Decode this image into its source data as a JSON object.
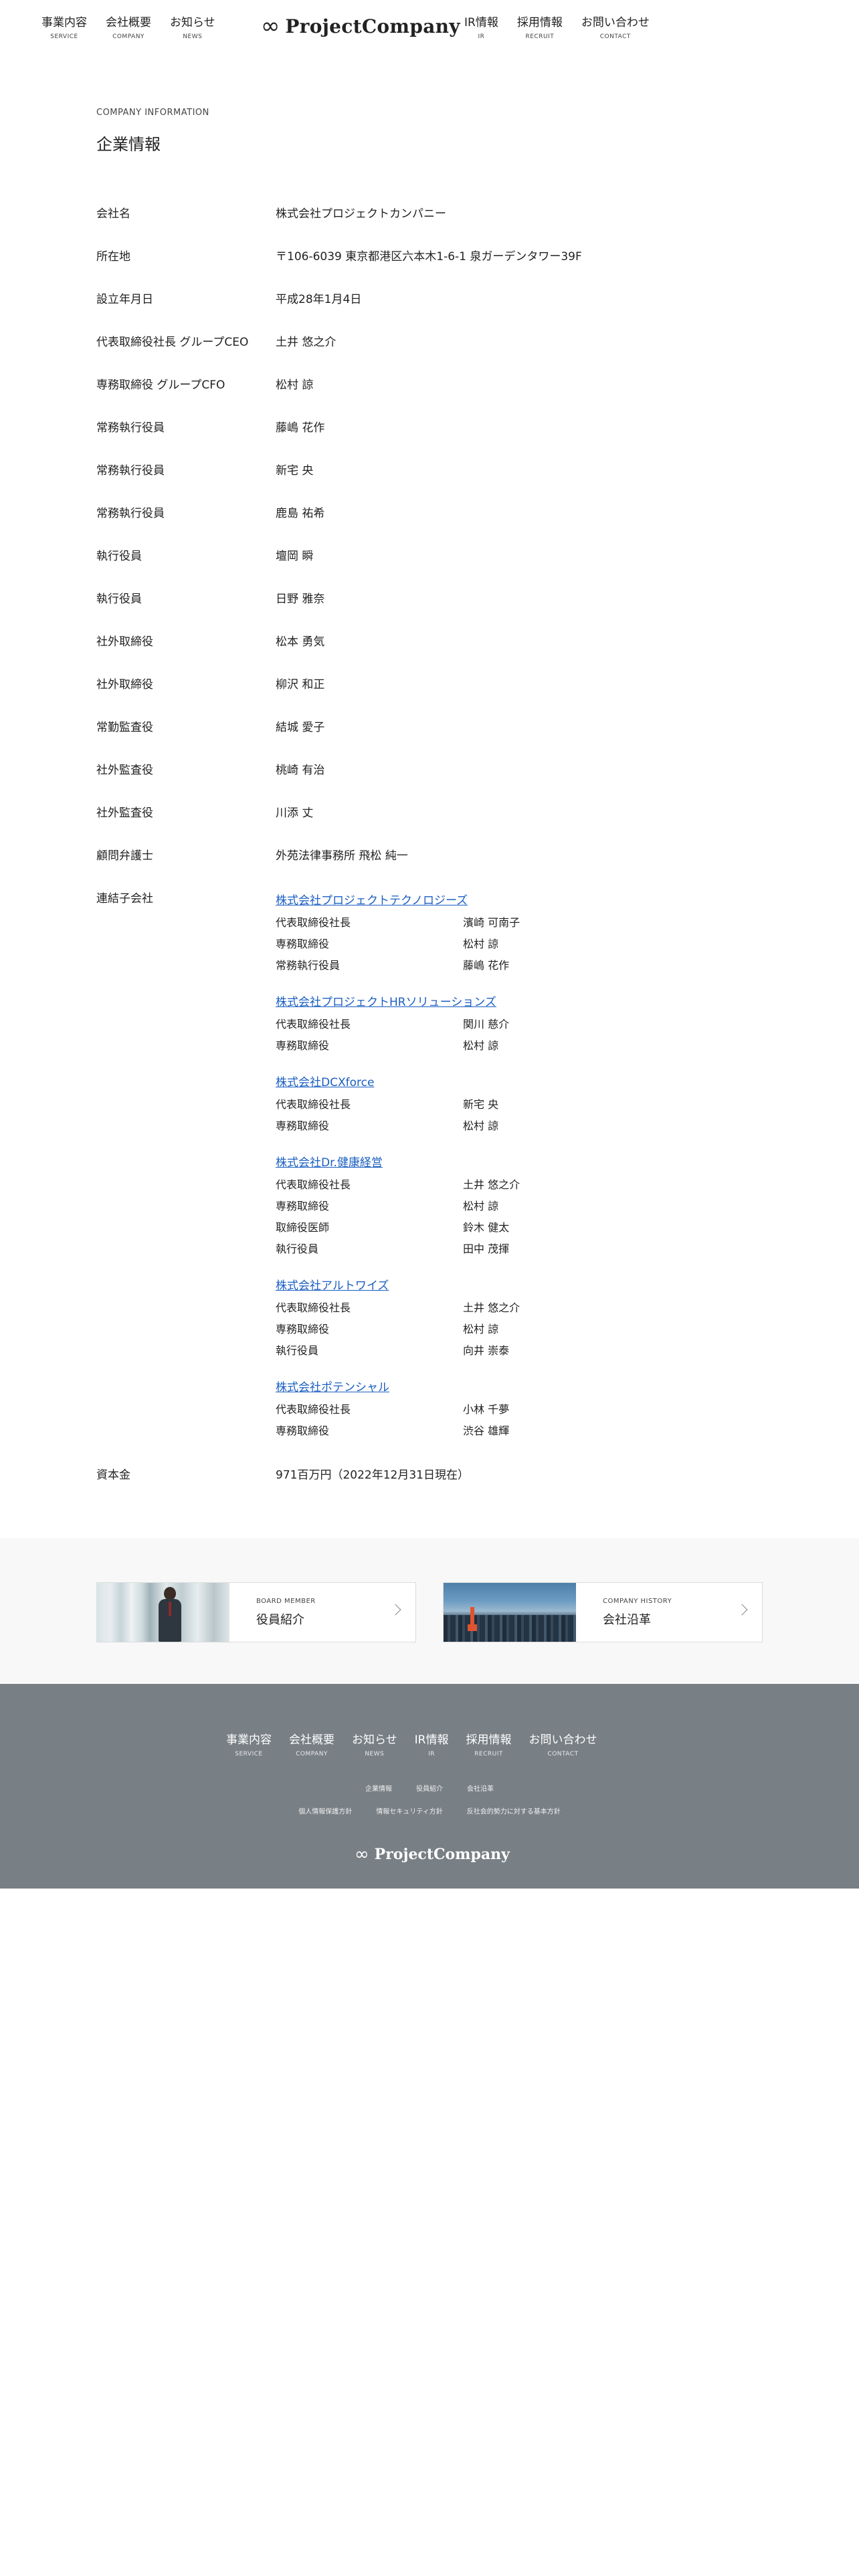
{
  "header": {
    "nav_left": [
      {
        "jp": "事業内容",
        "en": "SERVICE"
      },
      {
        "jp": "会社概要",
        "en": "COMPANY"
      },
      {
        "jp": "お知らせ",
        "en": "NEWS"
      }
    ],
    "logo_mark": "∞",
    "logo_text": "ProjectCompany",
    "nav_right": [
      {
        "jp": "IR情報",
        "en": "IR"
      },
      {
        "jp": "採用情報",
        "en": "RECRUIT"
      },
      {
        "jp": "お問い合わせ",
        "en": "CONTACT"
      }
    ]
  },
  "page": {
    "eyebrow": "COMPANY INFORMATION",
    "title": "企業情報"
  },
  "info": {
    "rows": [
      {
        "label": "会社名",
        "value": "株式会社プロジェクトカンパニー"
      },
      {
        "label": "所在地",
        "value": "〒106-6039 東京都港区六本木1-6-1 泉ガーデンタワー39F"
      },
      {
        "label": "設立年月日",
        "value": "平成28年1月4日"
      },
      {
        "label": "代表取締役社長 グループCEO",
        "value": "土井 悠之介"
      },
      {
        "label": "専務取締役 グループCFO",
        "value": "松村 諒"
      },
      {
        "label": "常務執行役員",
        "value": "藤嶋 花作"
      },
      {
        "label": "常務執行役員",
        "value": "新宅 央"
      },
      {
        "label": "常務執行役員",
        "value": "鹿島 祐希"
      },
      {
        "label": "執行役員",
        "value": "壇岡 瞬"
      },
      {
        "label": "執行役員",
        "value": "日野 雅奈"
      },
      {
        "label": "社外取締役",
        "value": "松本 勇気"
      },
      {
        "label": "社外取締役",
        "value": "柳沢 和正"
      },
      {
        "label": "常勤監査役",
        "value": "結城 愛子"
      },
      {
        "label": "社外監査役",
        "value": "桃崎 有治"
      },
      {
        "label": "社外監査役",
        "value": "川添 丈"
      },
      {
        "label": "顧問弁護士",
        "value": "外苑法律事務所 飛松 純一"
      }
    ],
    "subsidiaries_label": "連結子会社",
    "subsidiaries": [
      {
        "name": "株式会社プロジェクトテクノロジーズ",
        "officers": [
          {
            "role": "代表取締役社長",
            "name": "濱崎 可南子"
          },
          {
            "role": "専務取締役",
            "name": "松村 諒"
          },
          {
            "role": "常務執行役員",
            "name": "藤嶋 花作"
          }
        ]
      },
      {
        "name": "株式会社プロジェクトHRソリューションズ",
        "officers": [
          {
            "role": "代表取締役社長",
            "name": "関川 慈介"
          },
          {
            "role": "専務取締役",
            "name": "松村 諒"
          }
        ]
      },
      {
        "name": "株式会社DCXforce",
        "officers": [
          {
            "role": "代表取締役社長",
            "name": "新宅 央"
          },
          {
            "role": "専務取締役",
            "name": "松村 諒"
          }
        ]
      },
      {
        "name": "株式会社Dr.健康経営",
        "officers": [
          {
            "role": "代表取締役社長",
            "name": "土井 悠之介"
          },
          {
            "role": "専務取締役",
            "name": "松村 諒"
          },
          {
            "role": "取締役医師",
            "name": "鈴木 健太"
          },
          {
            "role": "執行役員",
            "name": "田中 茂揮"
          }
        ]
      },
      {
        "name": "株式会社アルトワイズ",
        "officers": [
          {
            "role": "代表取締役社長",
            "name": "土井 悠之介"
          },
          {
            "role": "専務取締役",
            "name": "松村 諒"
          },
          {
            "role": "執行役員",
            "name": "向井 崇泰"
          }
        ]
      },
      {
        "name": "株式会社ポテンシャル",
        "officers": [
          {
            "role": "代表取締役社長",
            "name": "小林 千夢"
          },
          {
            "role": "専務取締役",
            "name": "渋谷 雄輝"
          }
        ]
      }
    ],
    "capital_label": "資本金",
    "capital_value": "971百万円（2022年12月31日現在）"
  },
  "cards": [
    {
      "en": "BOARD MEMBER",
      "jp": "役員紹介"
    },
    {
      "en": "COMPANY HISTORY",
      "jp": "会社沿革"
    }
  ],
  "footer": {
    "nav": [
      {
        "jp": "事業内容",
        "en": "SERVICE"
      },
      {
        "jp": "会社概要",
        "en": "COMPANY"
      },
      {
        "jp": "お知らせ",
        "en": "NEWS"
      },
      {
        "jp": "IR情報",
        "en": "IR"
      },
      {
        "jp": "採用情報",
        "en": "RECRUIT"
      },
      {
        "jp": "お問い合わせ",
        "en": "CONTACT"
      }
    ],
    "links_row1": [
      "企業情報",
      "役員紹介",
      "会社沿革"
    ],
    "links_row2": [
      "個人情報保護方針",
      "情報セキュリティ方針",
      "反社会的勢力に対する基本方針"
    ],
    "logo_mark": "∞",
    "logo_text": "ProjectCompany"
  }
}
